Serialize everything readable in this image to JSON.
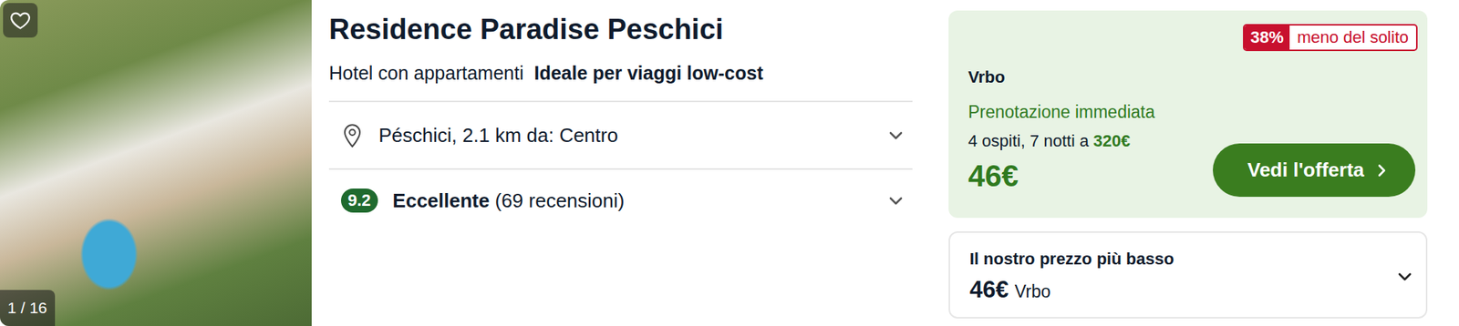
{
  "hotel": {
    "name": "Residence Paradise Peschici",
    "type": "Hotel con appartamenti",
    "tag": "Ideale per viaggi low-cost",
    "photo_counter": "1 / 16",
    "favorite": false
  },
  "details": [
    {
      "kind": "location",
      "text": "Péschici, 2.1 km da: Centro",
      "expanded": false
    },
    {
      "kind": "rating",
      "score": "9.2",
      "label": "Eccellente",
      "count": "(69 recensioni)",
      "expanded": false
    }
  ],
  "deal": {
    "discount": "38%",
    "discount_label": "meno del solito",
    "provider": "Vrbo",
    "booking": "Prenotazione immediata",
    "stay": "4 ospiti, 7 notti a",
    "stay_total": "320€",
    "price": "46€",
    "button": "Vedi l'offerta"
  },
  "lowest": {
    "label": "Il nostro prezzo più basso",
    "price": "46€",
    "provider": "Vrbo",
    "expanded": false
  }
}
